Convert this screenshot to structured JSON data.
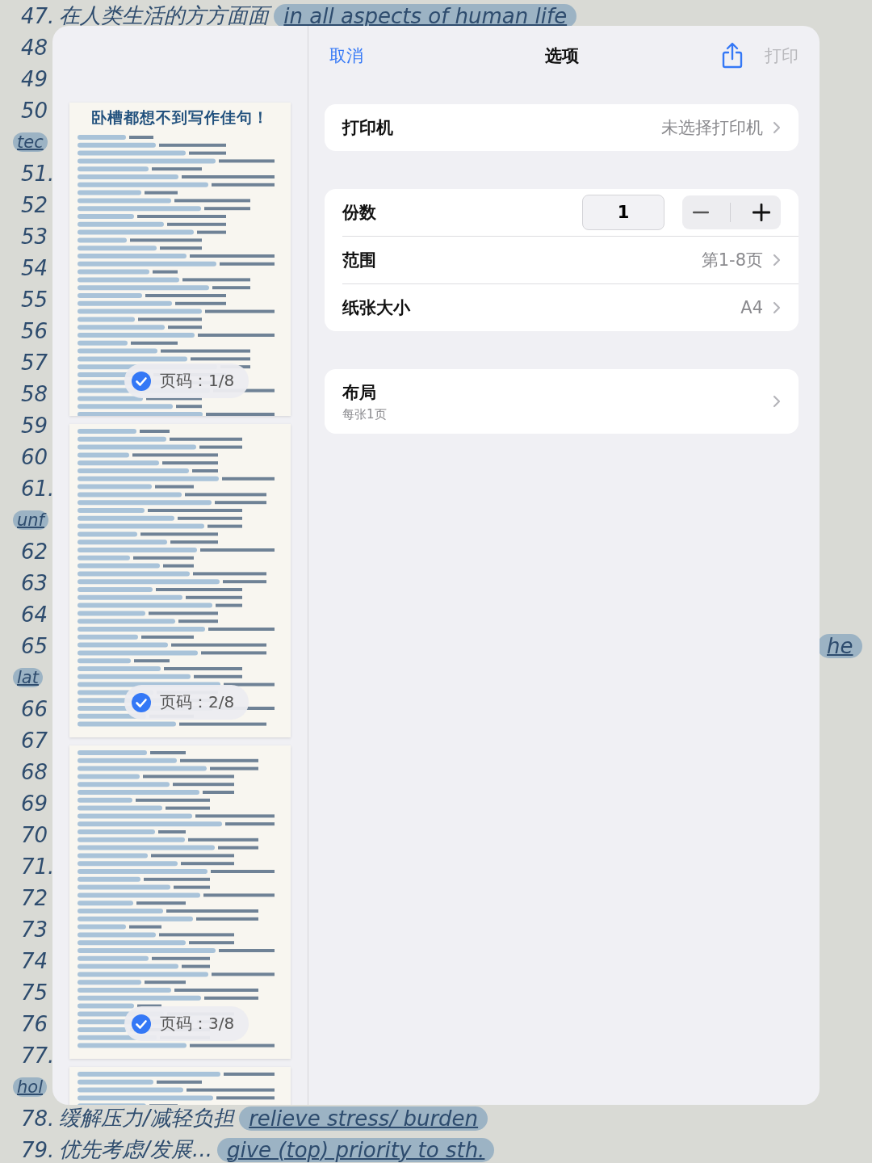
{
  "background_notes": {
    "lines": [
      {
        "kind": "entry",
        "number": "47.",
        "chinese": "在人类生活的方方面面",
        "english": "in all aspects of human life"
      },
      {
        "kind": "number",
        "number": "48"
      },
      {
        "kind": "number",
        "number": "49"
      },
      {
        "kind": "number",
        "number": "50"
      },
      {
        "kind": "tag",
        "tag": "tec"
      },
      {
        "kind": "number",
        "number": "51."
      },
      {
        "kind": "number",
        "number": "52"
      },
      {
        "kind": "number",
        "number": "53"
      },
      {
        "kind": "number",
        "number": "54"
      },
      {
        "kind": "number",
        "number": "55"
      },
      {
        "kind": "number",
        "number": "56"
      },
      {
        "kind": "number",
        "number": "57"
      },
      {
        "kind": "number",
        "number": "58"
      },
      {
        "kind": "number",
        "number": "59"
      },
      {
        "kind": "number",
        "number": "60"
      },
      {
        "kind": "number",
        "number": "61."
      },
      {
        "kind": "tag",
        "tag": "unf"
      },
      {
        "kind": "number",
        "number": "62"
      },
      {
        "kind": "number",
        "number": "63"
      },
      {
        "kind": "number",
        "number": "64"
      },
      {
        "kind": "number",
        "number": "65",
        "side_tag": "he"
      },
      {
        "kind": "tag",
        "tag": "lat"
      },
      {
        "kind": "number",
        "number": "66"
      },
      {
        "kind": "number",
        "number": "67"
      },
      {
        "kind": "number",
        "number": "68"
      },
      {
        "kind": "number",
        "number": "69"
      },
      {
        "kind": "number",
        "number": "70"
      },
      {
        "kind": "number",
        "number": "71."
      },
      {
        "kind": "number",
        "number": "72"
      },
      {
        "kind": "number",
        "number": "73"
      },
      {
        "kind": "number",
        "number": "74"
      },
      {
        "kind": "number",
        "number": "75"
      },
      {
        "kind": "number",
        "number": "76"
      },
      {
        "kind": "number",
        "number": "77."
      },
      {
        "kind": "tag",
        "tag": "hol"
      },
      {
        "kind": "entry",
        "number": "78.",
        "chinese": "缓解压力/减轻负担",
        "english": "relieve stress/ burden"
      },
      {
        "kind": "entry",
        "number": "79.",
        "chinese": "优先考虑/发展...",
        "english": "give (top) priority to sth."
      }
    ]
  },
  "print_dialog": {
    "pages": [
      {
        "kind": "full",
        "title": "卧槽都想不到写作佳句！",
        "selected": true,
        "badge": "页码：1/8"
      },
      {
        "kind": "full",
        "selected": true,
        "badge": "页码：2/8"
      },
      {
        "kind": "full",
        "selected": true,
        "badge": "页码：3/8"
      },
      {
        "kind": "partial"
      }
    ],
    "cancel_button": "取消",
    "title": "选项",
    "print_button": {
      "label": "打印",
      "disabled": true
    },
    "printer": {
      "label": "打印机",
      "value": "未选择打印机"
    },
    "copies": {
      "label": "份数",
      "value": "1"
    },
    "range": {
      "label": "范围",
      "value": "第1-8页"
    },
    "paper_size": {
      "label": "纸张大小",
      "value": "A4"
    },
    "layout": {
      "label": "布局",
      "subtitle": "每张1页"
    }
  }
}
